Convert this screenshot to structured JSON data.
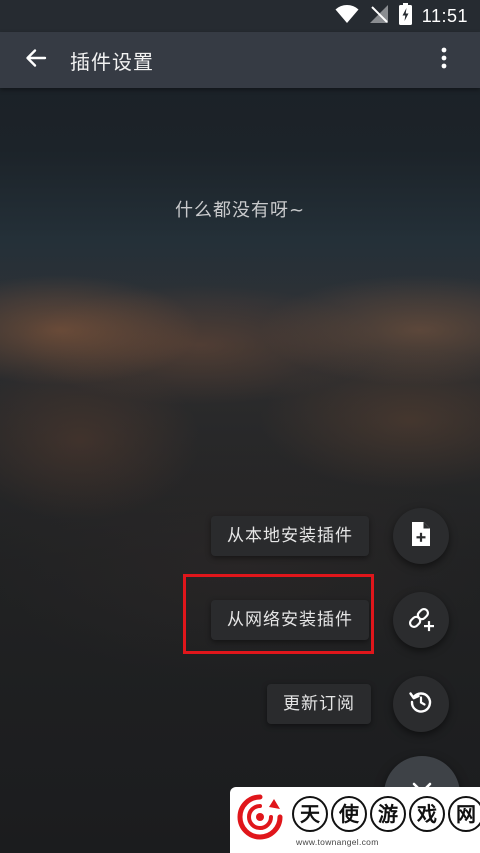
{
  "status_bar": {
    "time": "11:51",
    "icons": [
      "wifi-icon",
      "no-signal-icon",
      "battery-charging-icon"
    ]
  },
  "app_bar": {
    "title": "插件设置",
    "back_icon": "arrow-back-icon",
    "menu_icon": "more-vert-icon"
  },
  "main": {
    "empty_message": "什么都没有呀~"
  },
  "fab_menu": {
    "items": [
      {
        "label": "从本地安装插件",
        "icon": "add-file-icon"
      },
      {
        "label": "从网络安装插件",
        "icon": "link-add-icon"
      },
      {
        "label": "更新订阅",
        "icon": "refresh-icon"
      }
    ],
    "main_icon": "close-icon"
  },
  "annotation": {
    "highlight_color": "#e0161b"
  },
  "watermark": {
    "chars": [
      "天",
      "使",
      "游",
      "戏",
      "网"
    ],
    "url": "www.townangel.com"
  },
  "colors": {
    "status_bar": "#262b31",
    "app_bar": "#363b44",
    "fab_surface": "#2b2c2e",
    "text_primary": "#f2f2f2"
  }
}
